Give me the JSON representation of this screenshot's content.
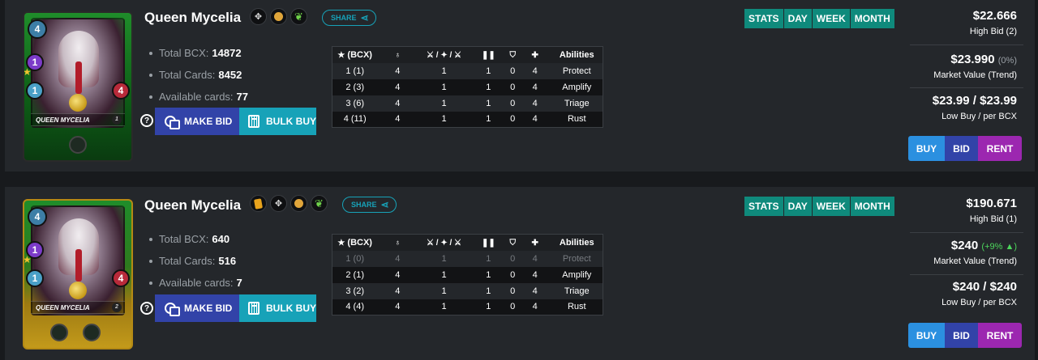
{
  "listings": [
    {
      "card": {
        "name_plate": "QUEEN MYCELIA",
        "level": "1",
        "mana": "4",
        "magic": "1",
        "speed": "1",
        "health": "4"
      },
      "title": "Queen Mycelia",
      "share_label": "SHARE",
      "stats": [
        {
          "label": "Total BCX:",
          "value": "14872"
        },
        {
          "label": "Total Cards:",
          "value": "8452"
        },
        {
          "label": "Available cards:",
          "value": "77"
        }
      ],
      "make_bid_label": "MAKE BID",
      "bulk_buy_label": "BULK BUY",
      "table": {
        "header_bcx": "(BCX)",
        "header_abilities": "Abilities",
        "rows": [
          {
            "lvl": "1 (1)",
            "mag": "4",
            "atk": "1",
            "spd": "1",
            "arm": "0",
            "hp": "4",
            "ability": "Protect"
          },
          {
            "lvl": "2 (3)",
            "mag": "4",
            "atk": "1",
            "spd": "1",
            "arm": "0",
            "hp": "4",
            "ability": "Amplify"
          },
          {
            "lvl": "3 (6)",
            "mag": "4",
            "atk": "1",
            "spd": "1",
            "arm": "0",
            "hp": "4",
            "ability": "Triage"
          },
          {
            "lvl": "4 (11)",
            "mag": "4",
            "atk": "1",
            "spd": "1",
            "arm": "0",
            "hp": "4",
            "ability": "Rust"
          }
        ]
      },
      "tabs": [
        "STATS",
        "DAY",
        "WEEK",
        "MONTH"
      ],
      "high_bid": {
        "value": "$22.666",
        "label": "High Bid (2)"
      },
      "market": {
        "value": "$23.990",
        "change": "(0%)",
        "label": "Market Value",
        "trend": "(Trend)"
      },
      "low_buy": {
        "value": "$23.99 / $23.99",
        "label": "Low Buy / per BCX"
      },
      "buy_label": "BUY",
      "bid_label": "BID",
      "rent_label": "RENT"
    },
    {
      "card": {
        "name_plate": "QUEEN MYCELIA",
        "level": "2",
        "mana": "4",
        "magic": "1",
        "speed": "1",
        "health": "4"
      },
      "title": "Queen Mycelia",
      "share_label": "SHARE",
      "stats": [
        {
          "label": "Total BCX:",
          "value": "640"
        },
        {
          "label": "Total Cards:",
          "value": "516"
        },
        {
          "label": "Available cards:",
          "value": "7"
        }
      ],
      "make_bid_label": "MAKE BID",
      "bulk_buy_label": "BULK BUY",
      "table": {
        "header_bcx": "(BCX)",
        "header_abilities": "Abilities",
        "rows": [
          {
            "lvl": "1 (0)",
            "mag": "4",
            "atk": "1",
            "spd": "1",
            "arm": "0",
            "hp": "4",
            "ability": "Protect"
          },
          {
            "lvl": "2 (1)",
            "mag": "4",
            "atk": "1",
            "spd": "1",
            "arm": "0",
            "hp": "4",
            "ability": "Amplify"
          },
          {
            "lvl": "3 (2)",
            "mag": "4",
            "atk": "1",
            "spd": "1",
            "arm": "0",
            "hp": "4",
            "ability": "Triage"
          },
          {
            "lvl": "4 (4)",
            "mag": "4",
            "atk": "1",
            "spd": "1",
            "arm": "0",
            "hp": "4",
            "ability": "Rust"
          }
        ]
      },
      "tabs": [
        "STATS",
        "DAY",
        "WEEK",
        "MONTH"
      ],
      "high_bid": {
        "value": "$190.671",
        "label": "High Bid (1)"
      },
      "market": {
        "value": "$240",
        "change": "(+9% ▲)",
        "label": "Market Value",
        "trend": "(Trend)"
      },
      "low_buy": {
        "value": "$240 / $240",
        "label": "Low Buy / per BCX"
      },
      "buy_label": "BUY",
      "bid_label": "BID",
      "rent_label": "RENT"
    }
  ],
  "colors": {
    "accent_teal": "#0f8a7c",
    "bid_blue": "#3243a8",
    "buy_blue": "#2b90e0",
    "rent_purple": "#9c27b0",
    "up_green": "#4cd65c"
  },
  "icons": [
    "element-icon",
    "neutral-icon",
    "earth-icon",
    "gold-foil-icon",
    "share-icon",
    "help-icon",
    "coins-icon",
    "calculator-icon",
    "star-icon",
    "magic-icon",
    "attack-icon",
    "speed-icon",
    "armor-icon",
    "health-icon"
  ]
}
